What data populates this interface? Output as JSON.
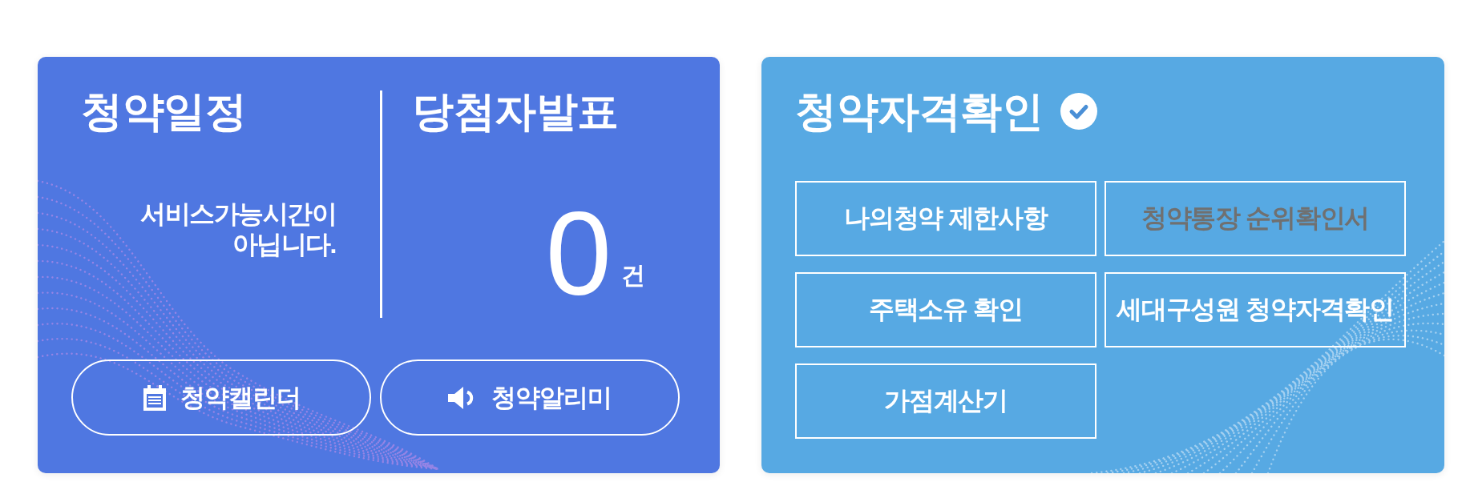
{
  "schedule_card": {
    "title": "청약일정",
    "message": "서비스가능시간이 아닙니다."
  },
  "announcement": {
    "title": "당첨자발표",
    "count": "0",
    "unit": "건"
  },
  "calendar_button": {
    "label": "청약캘린더"
  },
  "notification_button": {
    "label": "청약알리미"
  },
  "eligibility_card": {
    "title": "청약자격확인",
    "items": [
      {
        "label": "나의청약 제한사항",
        "disabled": false
      },
      {
        "label": "청약통장 순위확인서",
        "disabled": true
      },
      {
        "label": "주택소유 확인",
        "disabled": false
      },
      {
        "label": "세대구성원 청약자격확인",
        "disabled": false
      },
      {
        "label": "가점계산기",
        "disabled": false
      }
    ]
  }
}
